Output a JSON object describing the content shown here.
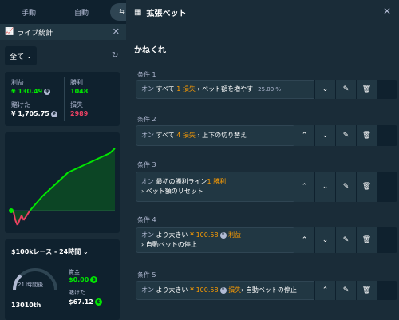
{
  "left": {
    "tabs": [
      "手動",
      "自動",
      "⇆"
    ],
    "live_stats_title": "ライブ統計",
    "filter": "全て",
    "stats": {
      "profit_label": "利益",
      "profit_value": "¥ 130.49",
      "wins_label": "勝利",
      "wins_value": "1048",
      "wagered_label": "賭けた",
      "wagered_value": "¥ 1,705.75",
      "losses_label": "損失",
      "losses_value": "2989"
    },
    "race": {
      "title": "$100kレース - 24時間",
      "timer": "21 時間後",
      "rank": "13010th",
      "prize_label": "賞金",
      "prize_value": "$0.00",
      "wagered_label": "賭けた",
      "wagered_value": "$67.12"
    }
  },
  "chart_data": {
    "type": "area",
    "x": [
      0,
      2,
      4,
      6,
      8,
      10,
      12,
      15,
      18,
      22,
      26,
      30,
      35,
      40,
      45,
      50,
      55,
      60,
      65,
      70,
      75,
      80,
      85,
      90,
      95,
      100
    ],
    "values": [
      0,
      0,
      -2,
      -3,
      -2,
      -1,
      -2,
      -1,
      0,
      1,
      2,
      3,
      4,
      5,
      6,
      7,
      8,
      8.5,
      9,
      9.5,
      10,
      10.5,
      11,
      11.5,
      12,
      13
    ],
    "ylim": [
      -3,
      14
    ],
    "colors": {
      "positive": "#00e701",
      "negative": "#ed4163"
    }
  },
  "right": {
    "title": "拡張ベット",
    "section": "かねくれ",
    "conditions": [
      {
        "label": "条件 1",
        "prefix": "オン",
        "t1": "すべて",
        "h1": "1 損失",
        "t2": "› ベット額を増やす",
        "extra": "25.00 %"
      },
      {
        "label": "条件 2",
        "prefix": "オン",
        "t1": "すべて",
        "h1": "4 損失",
        "t2": "› 上下の切り替え"
      },
      {
        "label": "条件 3",
        "prefix": "オン",
        "t1": "最初の勝利ライン",
        "h1": "1 勝利",
        "line2": "› ベット額のリセット"
      },
      {
        "label": "条件 4",
        "prefix": "オン",
        "t1": "より大きい",
        "h1": "¥ 100.58",
        "h2": "利益",
        "line2": "› 自動ベットの停止"
      },
      {
        "label": "条件 5",
        "prefix": "オン",
        "t1": "より大きい",
        "h1": "¥ 100.58",
        "h2": "損失",
        "t2": "› 自動ベットの停止"
      }
    ]
  }
}
